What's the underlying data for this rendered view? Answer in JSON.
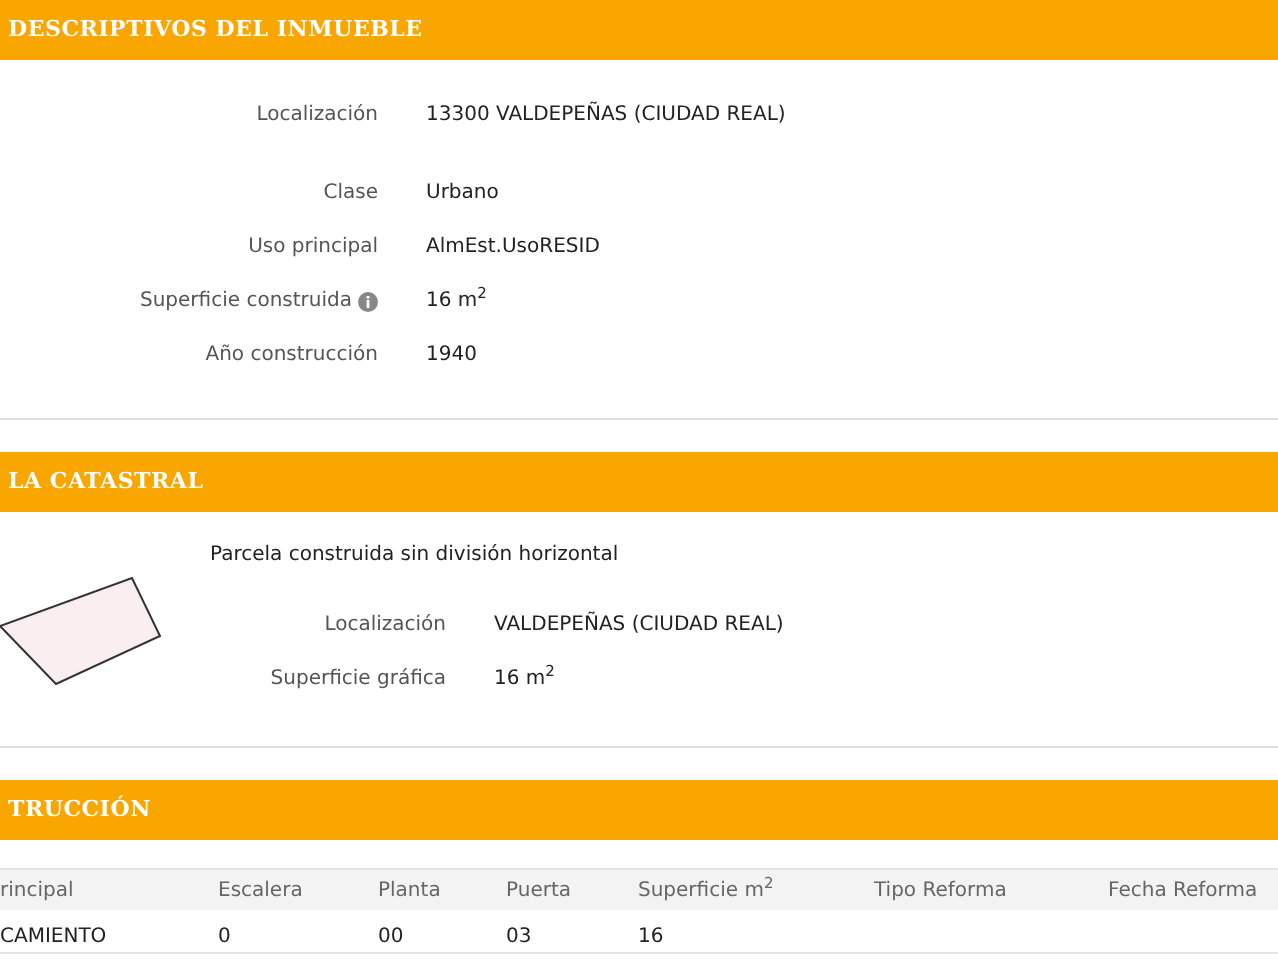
{
  "sections": [
    {
      "title": "DESCRIPTIVOS DEL INMUEBLE",
      "kind": "fields",
      "location": {
        "label": "Localización",
        "value": "13300 VALDEPEÑAS (CIUDAD REAL)"
      },
      "fields": [
        {
          "label": "Clase",
          "value": "Urbano"
        },
        {
          "label": "Uso principal",
          "value": "AlmEst.UsoRESID"
        },
        {
          "label": "Superficie construida",
          "value": "16 m$^{2}$",
          "info": true
        },
        {
          "label": "Año construcción",
          "value": "1940"
        }
      ]
    },
    {
      "title": "LA CATASTRAL",
      "kind": "parcel",
      "subtitle": "Parcela construida sin división horizontal",
      "fields": [
        {
          "label": "Localización",
          "value": "VALDEPEÑAS (CIUDAD REAL)"
        },
        {
          "label": "Superficie gráfica",
          "value": "16 m$^{2}$"
        }
      ]
    },
    {
      "title": "TRUCCIÓN",
      "kind": "table",
      "columns": [
        "rincipal",
        "Escalera",
        "Planta",
        "Puerta",
        "Superficie m$^{2}$",
        "Tipo Reforma",
        "Fecha Reforma"
      ],
      "rows": [
        [
          "CAMIENTO",
          "0",
          "00",
          "03",
          "16",
          "",
          ""
        ]
      ]
    }
  ]
}
